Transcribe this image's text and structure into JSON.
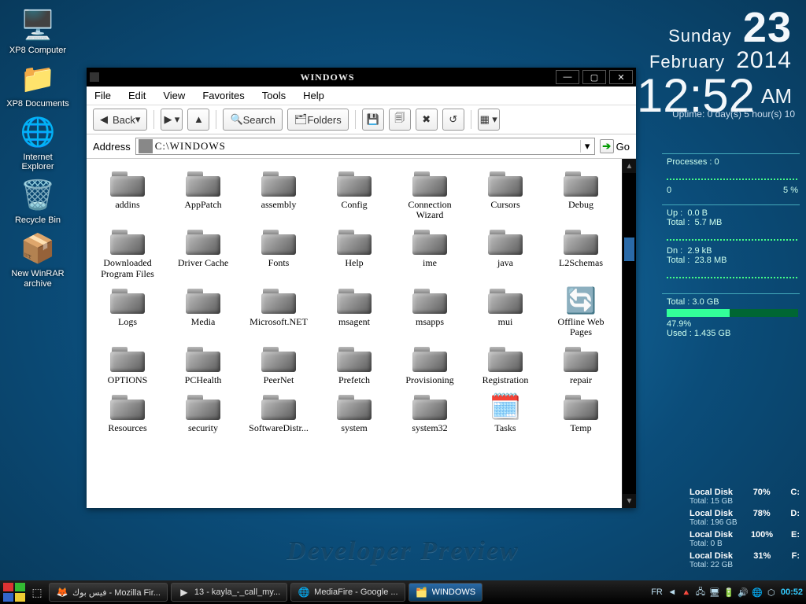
{
  "desktop": {
    "icons": [
      {
        "label": "XP8 Computer",
        "glyph": "🖥️"
      },
      {
        "label": "XP8 Documents",
        "glyph": "📁"
      },
      {
        "label": "Internet Explorer",
        "glyph": "🌐"
      },
      {
        "label": "Recycle Bin",
        "glyph": "🗑️"
      },
      {
        "label": "New WinRAR archive",
        "glyph": "📦"
      }
    ]
  },
  "clock": {
    "weekday": "Sunday",
    "month": "February",
    "day": "23",
    "year": "2014",
    "time": "12:52",
    "am": "AM"
  },
  "uptime": "Uptime: 0 day(s)  5 hour(s)  10",
  "sysmon": {
    "processes_label": "Processes : 0",
    "cpu_low": "0",
    "cpu_high": "5 %",
    "net_up_label": "Up :",
    "net_up_val": "0.0 B",
    "net_up_total_label": "Total :",
    "net_up_total_val": "5.7 MB",
    "net_dn_label": "Dn :",
    "net_dn_val": "2.9 kB",
    "net_dn_total_label": "Total :",
    "net_dn_total_val": "23.8 MB",
    "mem_total_label": "Total : 3.0 GB",
    "mem_pct": "47.9%",
    "mem_used": "Used : 1.435 GB"
  },
  "disks": [
    {
      "name": "Local Disk",
      "pct": "70%",
      "letter": "C:",
      "total": "Total: 15 GB"
    },
    {
      "name": "Local Disk",
      "pct": "78%",
      "letter": "D:",
      "total": "Total: 196 GB"
    },
    {
      "name": "Local Disk",
      "pct": "100%",
      "letter": "E:",
      "total": "Total: 0 B"
    },
    {
      "name": "Local Disk",
      "pct": "31%",
      "letter": "F:",
      "total": "Total: 22 GB"
    }
  ],
  "watermark": "Developer Preview",
  "window": {
    "title": "WINDOWS",
    "menu": [
      "File",
      "Edit",
      "View",
      "Favorites",
      "Tools",
      "Help"
    ],
    "toolbar": {
      "back": "Back",
      "search": "Search",
      "folders": "Folders"
    },
    "address_label": "Address",
    "address_value": "C:\\WINDOWS",
    "go_label": "Go",
    "items": [
      "addins",
      "AppPatch",
      "assembly",
      "Config",
      "Connection Wizard",
      "Cursors",
      "Debug",
      "Downloaded Program Files",
      "Driver Cache",
      "Fonts",
      "Help",
      "ime",
      "java",
      "L2Schemas",
      "Logs",
      "Media",
      "Microsoft.NET",
      "msagent",
      "msapps",
      "mui",
      "Offline Web Pages",
      "OPTIONS",
      "PCHealth",
      "PeerNet",
      "Prefetch",
      "Provisioning",
      "Registration",
      "repair",
      "Resources",
      "security",
      "SoftwareDistr...",
      "system",
      "system32",
      "Tasks",
      "Temp"
    ],
    "special_icons": {
      "Offline Web Pages": "🔄",
      "Tasks": "🗓️"
    }
  },
  "taskbar": {
    "tasks": [
      {
        "label": "فيس بوك - Mozilla Fir...",
        "glyph": "🦊",
        "active": false
      },
      {
        "label": "13 - kayla_-_call_my...",
        "glyph": "▶",
        "active": false
      },
      {
        "label": "MediaFire - Google ...",
        "glyph": "🌐",
        "active": false
      },
      {
        "label": "WINDOWS",
        "glyph": "🗂️",
        "active": true
      }
    ],
    "lang": "FR",
    "time": "00:52",
    "tray_icons": [
      "◄",
      "🔺",
      "🖧",
      "🖥",
      "🔋",
      "🔊",
      "🌐",
      "⬡"
    ]
  }
}
